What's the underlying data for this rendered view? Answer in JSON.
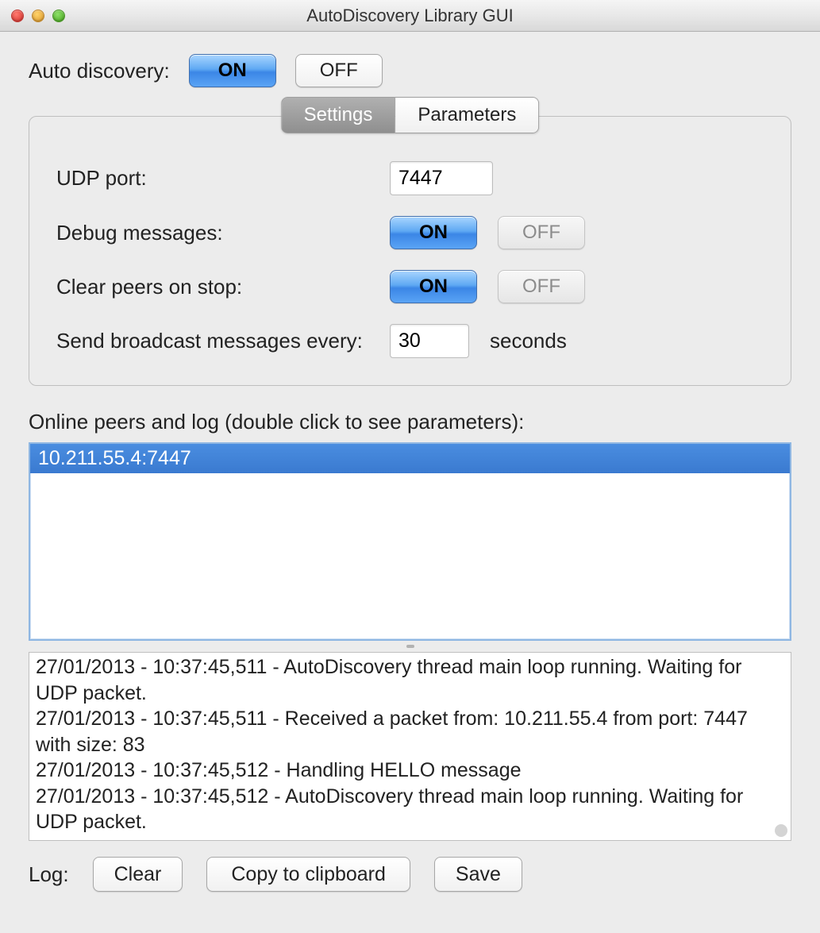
{
  "window": {
    "title": "AutoDiscovery Library GUI"
  },
  "auto_discovery": {
    "label": "Auto discovery:",
    "on": "ON",
    "off": "OFF"
  },
  "tabs": {
    "settings": "Settings",
    "parameters": "Parameters"
  },
  "settings": {
    "udp_port_label": "UDP port:",
    "udp_port_value": "7447",
    "debug_label": "Debug messages:",
    "debug_on": "ON",
    "debug_off": "OFF",
    "clear_label": "Clear peers on stop:",
    "clear_on": "ON",
    "clear_off": "OFF",
    "broadcast_label": "Send broadcast messages every:",
    "broadcast_value": "30",
    "broadcast_suffix": "seconds"
  },
  "peers": {
    "section_label": "Online peers and log (double click to see parameters):",
    "items": [
      "10.211.55.4:7447"
    ]
  },
  "log": {
    "text": "27/01/2013 - 10:37:45,511 - AutoDiscovery thread main loop running. Waiting for UDP packet.\n27/01/2013 - 10:37:45,511 - Received a packet from: 10.211.55.4 from port: 7447 with size: 83\n27/01/2013 - 10:37:45,512 - Handling HELLO message\n27/01/2013 - 10:37:45,512 - AutoDiscovery thread main loop running. Waiting for UDP packet."
  },
  "log_controls": {
    "label": "Log:",
    "clear": "Clear",
    "copy": "Copy to clipboard",
    "save": "Save"
  }
}
